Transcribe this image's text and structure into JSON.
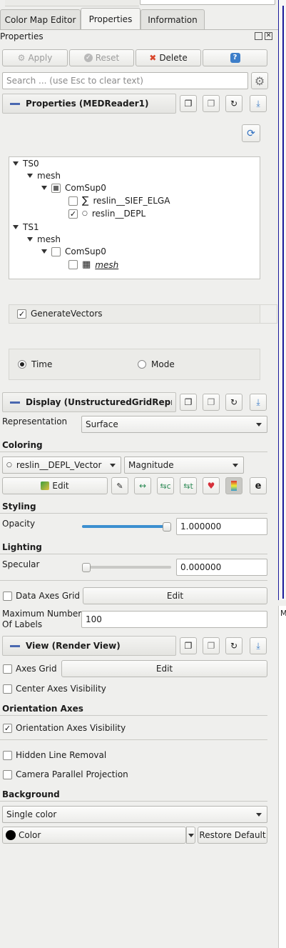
{
  "tabs": {
    "color_map_editor": "Color Map Editor",
    "properties": "Properties",
    "information": "Information"
  },
  "panel_title": "Properties",
  "toolbar": {
    "apply": "Apply",
    "reset": "Reset",
    "delete": "Delete",
    "help": "?"
  },
  "search": {
    "placeholder": "Search ... (use Esc to clear text)"
  },
  "properties_group": {
    "title": "Properties (MEDReader1)"
  },
  "tree": {
    "ts0": "TS0",
    "mesh0": "mesh",
    "comsup0": "ComSup0",
    "field1": "reslin__SIEF_ELGA",
    "field2": "reslin__DEPL",
    "ts1": "TS1",
    "mesh1": "mesh",
    "comsup1": "ComSup0",
    "mesh_leaf": "mesh"
  },
  "generate_vectors": {
    "label": "GenerateVectors",
    "checked": true
  },
  "mode_radio": {
    "time": "Time",
    "mode": "Mode",
    "selected": "Time"
  },
  "display_group": {
    "title": "Display (UnstructuredGridRepresentation)"
  },
  "representation": {
    "label": "Representation",
    "value": "Surface"
  },
  "coloring": {
    "section": "Coloring",
    "array": "reslin__DEPL_Vector",
    "component": "Magnitude",
    "edit": "Edit"
  },
  "styling": {
    "section": "Styling",
    "opacity_label": "Opacity",
    "opacity_value": "1.000000",
    "opacity": 1.0
  },
  "lighting": {
    "section": "Lighting",
    "specular_label": "Specular",
    "specular_value": "0.000000",
    "specular": 0.0
  },
  "data_axes_grid": {
    "label": "Data Axes Grid",
    "edit": "Edit"
  },
  "max_labels": {
    "label_line1": "Maximum Number",
    "label_line2": "Of Labels",
    "value": "100"
  },
  "view_group": {
    "title": "View (Render View)"
  },
  "axes_grid": {
    "label": "Axes Grid",
    "edit": "Edit"
  },
  "center_axes": {
    "label": "Center Axes Visibility"
  },
  "orientation_axes": {
    "section": "Orientation Axes",
    "label": "Orientation Axes Visibility"
  },
  "hidden_line_removal": {
    "label": "Hidden Line Removal"
  },
  "camera_parallel": {
    "label": "Camera Parallel Projection"
  },
  "background": {
    "section": "Background",
    "mode": "Single color",
    "color_label": "Color",
    "restore": "Restore Default"
  },
  "colors": {
    "accent": "#3c8fd0",
    "group_dash": "#4a68b0",
    "delete_x": "#d9462b",
    "window_border": "#1a1a9a"
  }
}
